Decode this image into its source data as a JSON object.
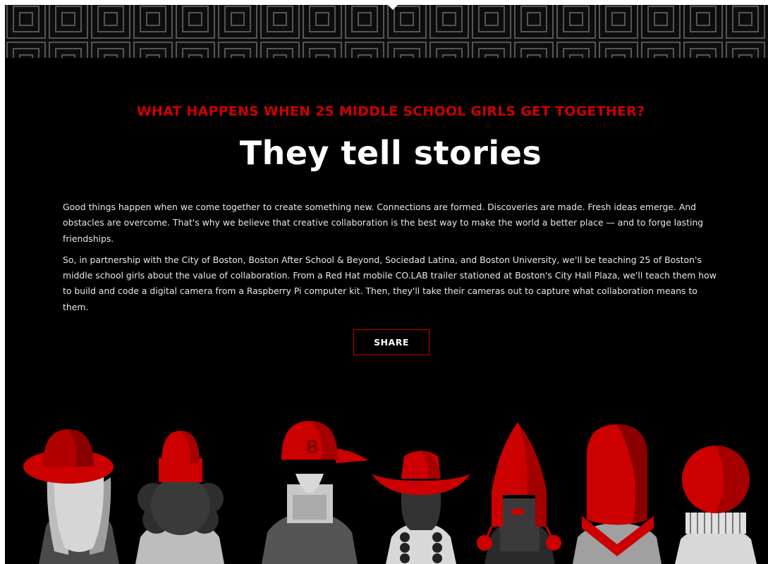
{
  "hero": {
    "eyebrow": "WHAT HAPPENS WHEN 25 MIDDLE SCHOOL GIRLS GET TOGETHER?",
    "headline": "They tell stories"
  },
  "body": {
    "paragraph_1": "Good things happen when we come together to create something new. Connections are formed. Discoveries are made. Fresh ideas emerge. And obstacles are overcome. That's why we believe that creative collaboration is the best way to make the world a better place — and to forge lasting friendships.",
    "paragraph_2": "So, in partnership with the City of Boston, Boston After School & Beyond, Sociedad Latina, and Boston University, we'll be teaching 25 of Boston's middle school girls about the value of collaboration. From a Red Hat mobile CO.LAB trailer stationed at Boston's City Hall Plaza, we'll teach them how to build and code a digital camera from a Raspberry Pi computer kit. Then, they'll take their cameras out to capture what collaboration means to them."
  },
  "share": {
    "label": "SHARE"
  },
  "illustration": {
    "cap_letter": "B"
  },
  "colors": {
    "accent": "#cc0000",
    "background": "#000000",
    "text": "#ffffff"
  }
}
